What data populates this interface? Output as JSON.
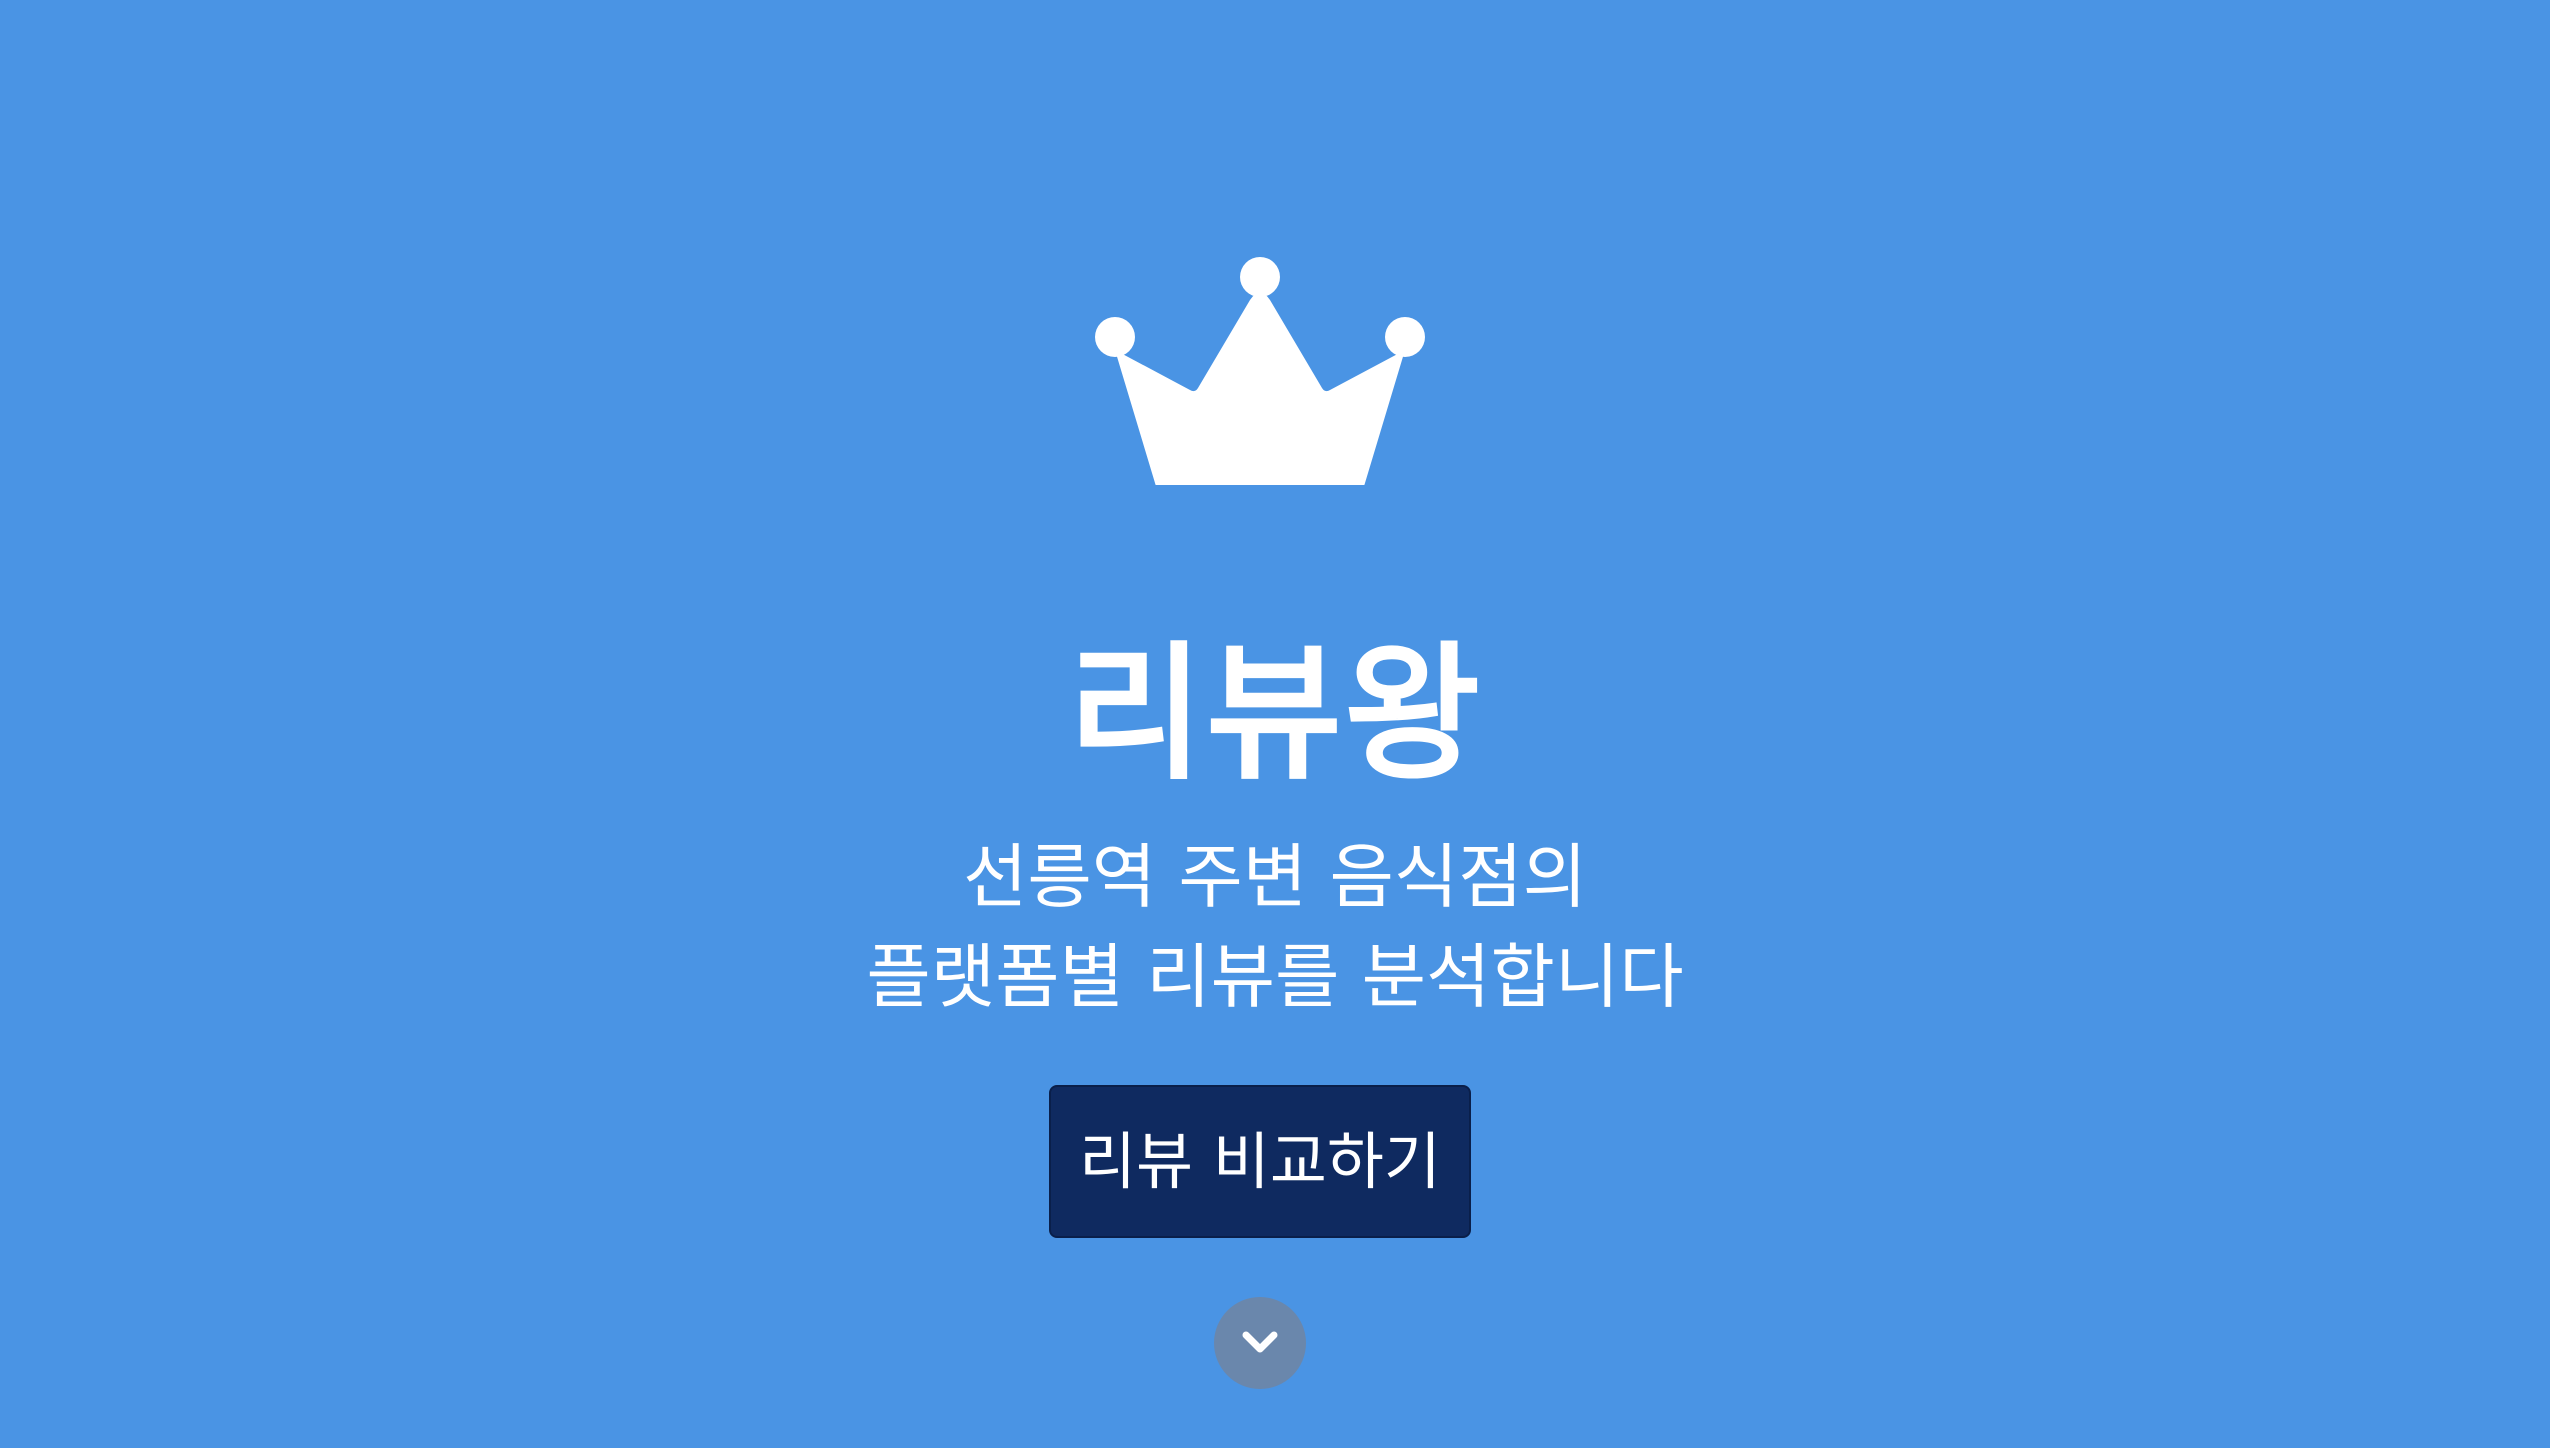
{
  "hero": {
    "logo_icon": "crown-icon",
    "title": "리뷰왕",
    "subtitle_line1": "선릉역 주변 음식점의",
    "subtitle_line2": "플랫폼별 리뷰를 분석합니다",
    "cta_label": "리뷰 비교하기",
    "scroll_icon": "chevron-down-icon"
  },
  "colors": {
    "background": "#4a94e4",
    "cta_background": "#0f2a60",
    "scroll_button": "#6a87ac",
    "text": "#ffffff"
  }
}
